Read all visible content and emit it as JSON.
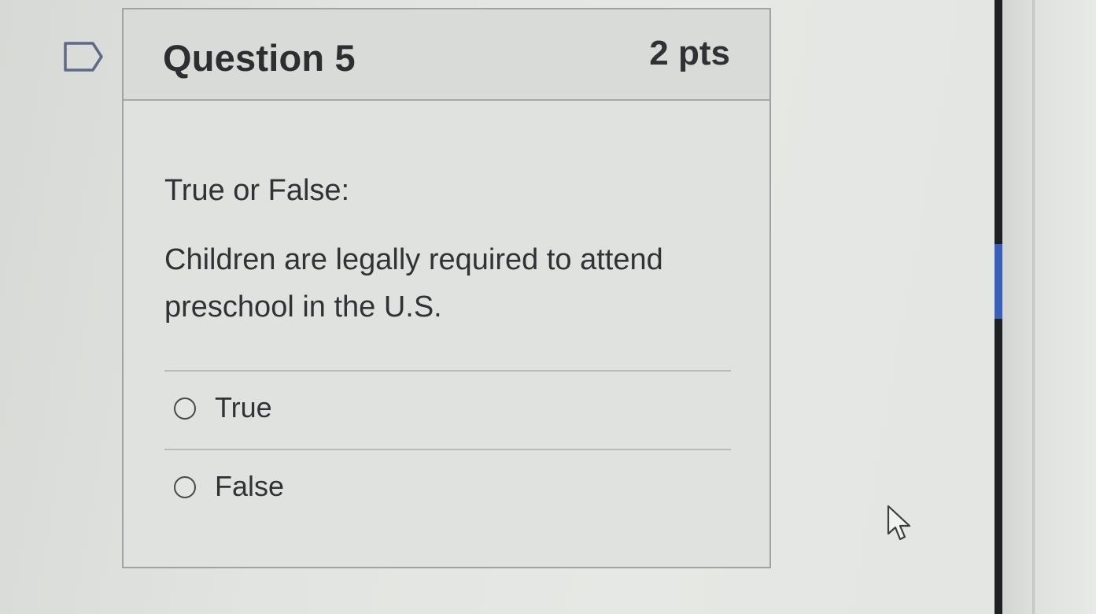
{
  "question": {
    "title": "Question 5",
    "points": "2 pts",
    "intro": "True or False:",
    "text": "Children are legally required to attend preschool in the U.S.",
    "flag_icon": "flag-outline-icon"
  },
  "answers": [
    {
      "label": "True",
      "selected": false
    },
    {
      "label": "False",
      "selected": false
    }
  ],
  "colors": {
    "background": "#e2e4e1",
    "text": "#2f3336",
    "scroll_thumb": "#3a5fb8"
  }
}
